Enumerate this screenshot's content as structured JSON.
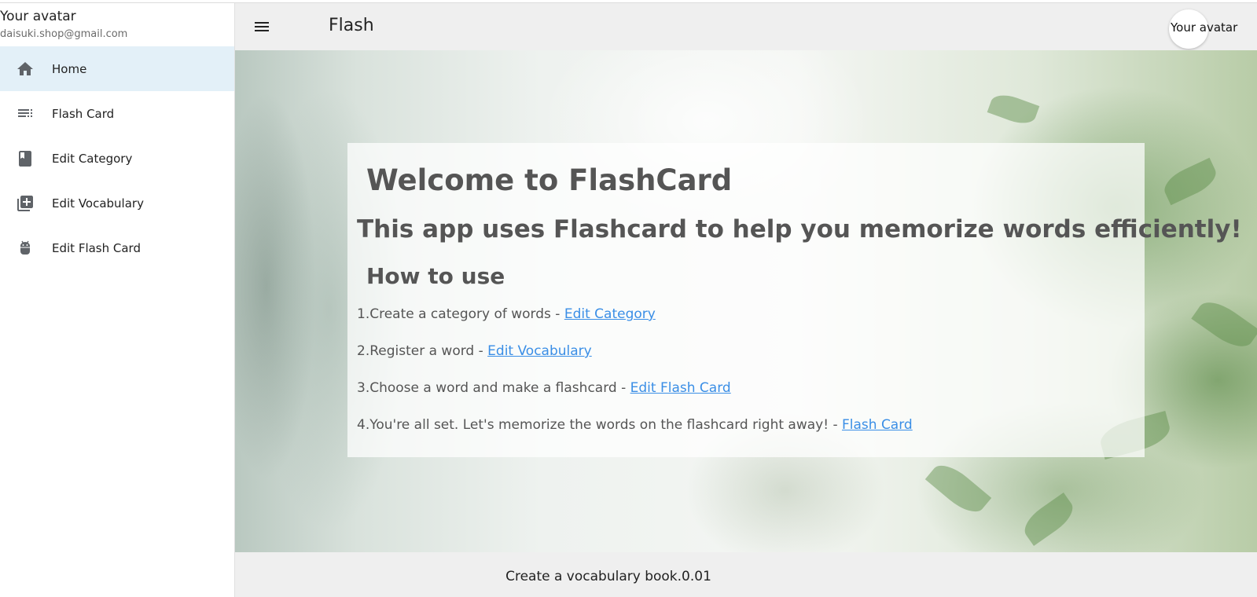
{
  "sidebar": {
    "user_name": "Your avatar",
    "user_email": "daisuki.shop@gmail.com",
    "items": [
      {
        "label": "Home",
        "icon": "home-icon"
      },
      {
        "label": "Flash Card",
        "icon": "list-icon"
      },
      {
        "label": "Edit Category",
        "icon": "book-icon"
      },
      {
        "label": "Edit Vocabulary",
        "icon": "library-add-icon"
      },
      {
        "label": "Edit Flash Card",
        "icon": "android-icon"
      }
    ]
  },
  "appbar": {
    "title": "Flash",
    "avatar_label": "Your avatar"
  },
  "main": {
    "welcome": "Welcome to FlashCard",
    "subtitle": "This app uses Flashcard to help you memorize words efficiently!",
    "howto": "How to use",
    "steps": [
      {
        "text": "1.Create a category of words - ",
        "link": "Edit Category"
      },
      {
        "text": "2.Register a word - ",
        "link": "Edit Vocabulary"
      },
      {
        "text": "3.Choose a word and make a flashcard - ",
        "link": "Edit Flash Card"
      },
      {
        "text": "4.You're all set. Let's memorize the words on the flashcard right away! - ",
        "link": "Flash Card"
      }
    ]
  },
  "footer": {
    "text": "Create a vocabulary book.0.01"
  },
  "colors": {
    "active_nav": "#e3f0f8",
    "link": "#3a8ee6",
    "appbar_bg": "#efefef"
  }
}
